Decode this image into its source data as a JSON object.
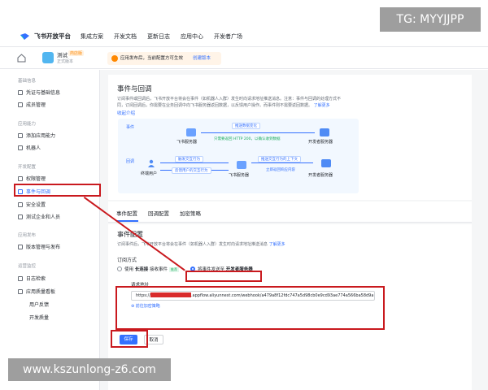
{
  "header": {
    "logo_text": "飞书开放平台",
    "nav": [
      "集成方案",
      "开发文档",
      "更新日志",
      "应用中心",
      "开发者广场"
    ]
  },
  "watermarks": {
    "top": "TG: MYYJJPP",
    "bottom": "www.kszunlong-z6.com"
  },
  "app": {
    "name": "测试",
    "tag": "商店版",
    "status": "正式版本",
    "notice": "应用发布后，当前配置方可生效",
    "notice_link": "创建版本"
  },
  "sidebar": {
    "sections": [
      {
        "title": "基础信息",
        "items": [
          "凭证与基础信息",
          "成员管理"
        ]
      },
      {
        "title": "应用能力",
        "items": [
          "添加应用能力",
          "机器人"
        ]
      },
      {
        "title": "开发配置",
        "items": [
          "权限管理",
          "事件与回调",
          "安全设置",
          "测试企业和人员"
        ]
      },
      {
        "title": "应用发布",
        "items": [
          "版本管理与发布"
        ]
      },
      {
        "title": "运营监控",
        "items": [
          "日志检索",
          "应用质量看板"
        ]
      }
    ],
    "subitems": [
      "用户反馈",
      "开发质量"
    ]
  },
  "card": {
    "title": "事件与回调",
    "desc": "订阅事件或回调后，飞书开放平台将会在事件（如机器人入群）发生时向请求地址推送消息。注意：事件与回调的处理方式不同，订阅回调后，你需要在业务回调中向飞书服务器返回数据，以反馈用户操作。而事件则不需要返回数据。",
    "desc_link": "了解更多",
    "expand": "收起介绍",
    "diagram": {
      "event_tag": "事件",
      "callback_tag": "回调",
      "feishu_server": "飞书服务器",
      "dev_server": "开发者服务器",
      "user": "终端用户",
      "push_change": "推送数据变化",
      "event_note": "只需要返回 HTTP 200，以确认收到数据",
      "trigger": "触发交互行为",
      "push_context": "推送交互行为的上下文",
      "feedback": "反馈用户的交互行为",
      "respond": "立即返回响应内容"
    }
  },
  "tabs": [
    "事件配置",
    "回调配置",
    "加密策略"
  ],
  "config": {
    "title": "事件配置",
    "desc": "订阅事件后，飞书开放平台将会在事件（如机器人入群）发生时向请求地址推送消息",
    "desc_link": "了解更多",
    "subscribe_label": "订阅方式",
    "option1_prefix": "使用",
    "option1_bold": "长连接",
    "option1_suffix": "接收事件",
    "option1_badge": "推荐",
    "option2_prefix": "将事件发送至",
    "option2_bold": "开发者服务器",
    "url_label": "请求地址",
    "url_prefix": "https://",
    "url_suffix": ".appflow.aliyunnest.com/webhook/a479a8f12fdc747a5d98cb0e9cd93ae774a566ba58d9a",
    "add_encrypt": "前往加密策略",
    "save": "保存",
    "cancel": "取消"
  },
  "colors": {
    "accent": "#3370ff",
    "annotation_red": "#c9191e",
    "warning": "#ff8800"
  }
}
